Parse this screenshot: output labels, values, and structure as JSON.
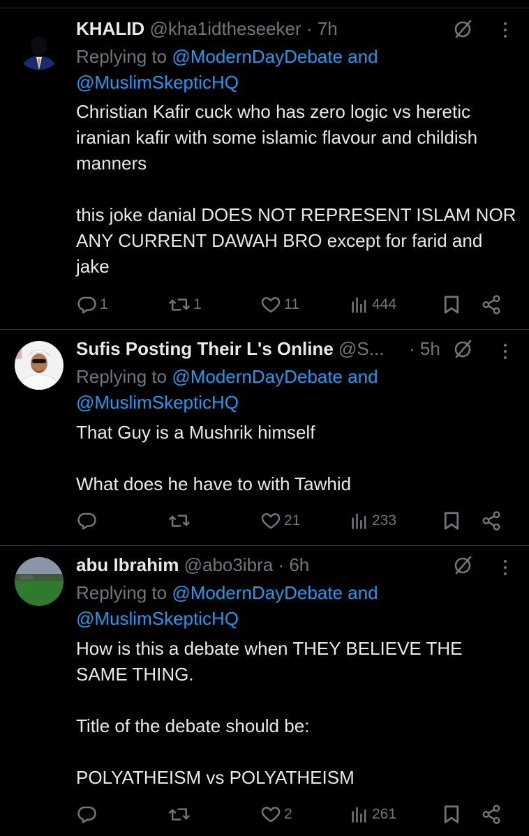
{
  "tweets": [
    {
      "name": "KHALID",
      "handle": "@kha1idtheseeker",
      "dot": "·",
      "time": "7h",
      "reply_prefix": "Replying to",
      "reply_mention_1": "@ModernDayDebate and",
      "reply_mention_2": "@MuslimSkepticHQ",
      "text": "Christian Kafir cuck who has zero logic vs heretic iranian kafir with some islamic flavour and childish manners\n\nthis joke danial DOES NOT REPRESENT ISLAM NOR ANY CURRENT DAWAH BRO except for farid and jake",
      "replies": "1",
      "retweets": "1",
      "likes": "11",
      "views": "444"
    },
    {
      "name": "Sufis Posting Their L's Online",
      "handle": "@S...",
      "dot": "·",
      "time": "5h",
      "reply_prefix": "Replying to",
      "reply_mention_1": "@ModernDayDebate and",
      "reply_mention_2": "@MuslimSkepticHQ",
      "text": "That Guy is a Mushrik himself\n\nWhat does he have to with Tawhid",
      "replies": "",
      "retweets": "",
      "likes": "21",
      "views": "233"
    },
    {
      "name": "abu Ibrahim",
      "handle": "@abo3ibra",
      "dot": "·",
      "time": "6h",
      "reply_prefix": "Replying to",
      "reply_mention_1": "@ModernDayDebate and",
      "reply_mention_2": "@MuslimSkepticHQ",
      "text": "How is this a debate when THEY BELIEVE THE SAME THING.\n\nTitle of the debate should be:\n\nPOLYATHEISM vs POLYATHEISM",
      "replies": "",
      "retweets": "",
      "likes": "2",
      "views": "261"
    }
  ],
  "icons": {
    "reply": "speech-bubble-icon",
    "retweet": "retweet-arrows-icon",
    "like": "heart-icon",
    "views": "bar-chart-icon",
    "bookmark": "bookmark-icon",
    "share": "share-icon",
    "grok": "slashed-circle-icon",
    "more": "vertical-ellipsis-icon"
  },
  "colors": {
    "background": "#000000",
    "text": "#e7e9ea",
    "muted": "#71767b",
    "link": "#1d9bf0",
    "divider": "#2f3336"
  }
}
